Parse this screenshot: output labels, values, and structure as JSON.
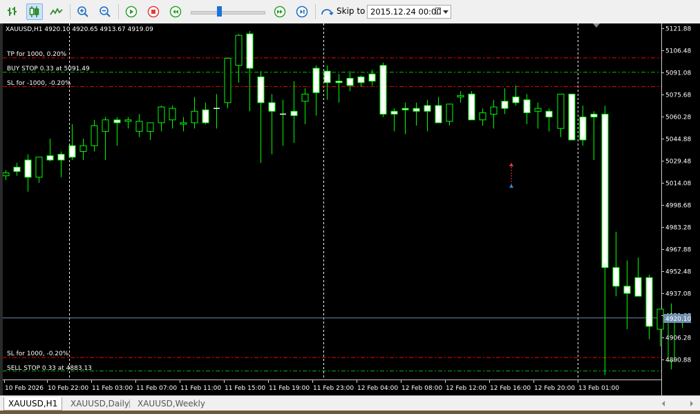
{
  "toolbar": {
    "skip_label": "Skip to",
    "skip_value": "2015.12.24 00:00",
    "slider_value": 0.38
  },
  "chart_info": {
    "symbol_line": "XAUUSD,H1  4920.10  4920.65  4913.67  4919.09",
    "current_price_label": "4920.10"
  },
  "order_labels": {
    "tp": "TP for 1000, 0.20%",
    "buy_stop": "BUY STOP 0.33 at 5091.49",
    "sl_top": "SL for -1000, -0.20%",
    "sl_bottom": "SL for 1000, -0.20%",
    "sell_stop": "SELL STOP 0.33 at 4883.13"
  },
  "tabs": [
    "XAUUSD,H1",
    "XAUUSD,Daily",
    "XAUUSD,Weekly"
  ],
  "colors": {
    "background": "#000000",
    "bull_body": "#000000",
    "bear_body": "#ffffff",
    "wick": "#00ff00",
    "tp_sl_line": "#ff0000",
    "order_line": "#00c000",
    "current_price_line": "#6f8faf",
    "separator": "#ffffff"
  },
  "chart_data": {
    "type": "candlestick",
    "y_ticks": [
      "5121.88",
      "5106.48",
      "5091.08",
      "5075.68",
      "5060.28",
      "5044.88",
      "5029.48",
      "5014.08",
      "4998.68",
      "4983.28",
      "4967.88",
      "4952.48",
      "4937.08",
      "4921.68",
      "4906.28",
      "4890.88"
    ],
    "ylim": [
      4875,
      5125
    ],
    "x_labels": [
      "10 Feb 2026",
      "10 Feb 22:00",
      "11 Feb 03:00",
      "11 Feb 07:00",
      "11 Feb 11:00",
      "11 Feb 15:00",
      "11 Feb 19:00",
      "11 Feb 23:00",
      "12 Feb 04:00",
      "12 Feb 08:00",
      "12 Feb 12:00",
      "12 Feb 16:00",
      "12 Feb 20:00",
      "13 Feb 01:00"
    ],
    "levels": {
      "tp": 5101.5,
      "buy_stop": 5091.49,
      "sl_top": 5081.5,
      "sl_bottom": 4892.5,
      "sell_stop": 4883.13,
      "current": 4920.1
    },
    "candles": [
      [
        5019,
        5023,
        5016,
        5021
      ],
      [
        5025,
        5028,
        5019,
        5022
      ],
      [
        5030,
        5034,
        5008,
        5018
      ],
      [
        5018,
        5032,
        5014,
        5032
      ],
      [
        5033,
        5045,
        5029,
        5030
      ],
      [
        5034,
        5036,
        5018,
        5030
      ],
      [
        5040,
        5055,
        5030,
        5032
      ],
      [
        5036,
        5045,
        5030,
        5040
      ],
      [
        5040,
        5058,
        5036,
        5054
      ],
      [
        5050,
        5060,
        5030,
        5058
      ],
      [
        5058,
        5060,
        5040,
        5056
      ],
      [
        5057,
        5060,
        5052,
        5058
      ],
      [
        5050,
        5062,
        5046,
        5057
      ],
      [
        5050,
        5055,
        5044,
        5056
      ],
      [
        5056,
        5068,
        5050,
        5067
      ],
      [
        5058,
        5068,
        5052,
        5066
      ],
      [
        5055,
        5060,
        5050,
        5056
      ],
      [
        5056,
        5074,
        5052,
        5064
      ],
      [
        5065,
        5070,
        5055,
        5056
      ],
      [
        5066,
        5076,
        5052,
        5066
      ],
      [
        5070,
        5100,
        5066,
        5101
      ],
      [
        5096,
        5118,
        5084,
        5117
      ],
      [
        5118,
        5120,
        5064,
        5094
      ],
      [
        5088,
        5092,
        5028,
        5070
      ],
      [
        5070,
        5076,
        5034,
        5064
      ],
      [
        5062,
        5072,
        5040,
        5062
      ],
      [
        5064,
        5085,
        5042,
        5061
      ],
      [
        5071,
        5080,
        5055,
        5076
      ],
      [
        5094,
        5096,
        5061,
        5077
      ],
      [
        5092,
        5096,
        5072,
        5084
      ],
      [
        5085,
        5090,
        5070,
        5084
      ],
      [
        5087,
        5092,
        5078,
        5082
      ],
      [
        5088,
        5089,
        5081,
        5084
      ],
      [
        5090,
        5093,
        5082,
        5085
      ],
      [
        5096,
        5098,
        5060,
        5062
      ],
      [
        5064,
        5066,
        5050,
        5062
      ],
      [
        5066,
        5070,
        5048,
        5065
      ],
      [
        5066,
        5070,
        5054,
        5064
      ],
      [
        5068,
        5072,
        5050,
        5064
      ],
      [
        5068,
        5074,
        5057,
        5056
      ],
      [
        5057,
        5062,
        5054,
        5069
      ],
      [
        5074,
        5078,
        5070,
        5075
      ],
      [
        5076,
        5078,
        5058,
        5058
      ],
      [
        5058,
        5066,
        5054,
        5063
      ],
      [
        5062,
        5072,
        5052,
        5067
      ],
      [
        5071,
        5080,
        5062,
        5066
      ],
      [
        5074,
        5082,
        5068,
        5070
      ],
      [
        5072,
        5076,
        5055,
        5063
      ],
      [
        5064,
        5070,
        5052,
        5066
      ],
      [
        5064,
        5066,
        5050,
        5060
      ],
      [
        5052,
        5072,
        5046,
        5076
      ],
      [
        5076,
        5076,
        5048,
        5044
      ],
      [
        5060,
        5068,
        5040,
        5044
      ],
      [
        5062,
        5064,
        5030,
        5060
      ],
      [
        5062,
        5068,
        4880,
        4955
      ],
      [
        4955,
        4980,
        4935,
        4942
      ],
      [
        4942,
        4960,
        4912,
        4937
      ],
      [
        4948,
        4962,
        4935,
        4935
      ],
      [
        4948,
        4950,
        4905,
        4914
      ],
      [
        4912,
        4925,
        4900,
        4926
      ],
      [
        4890,
        4930,
        4884,
        4920
      ],
      [
        4920,
        4921,
        4913,
        4919
      ]
    ]
  }
}
